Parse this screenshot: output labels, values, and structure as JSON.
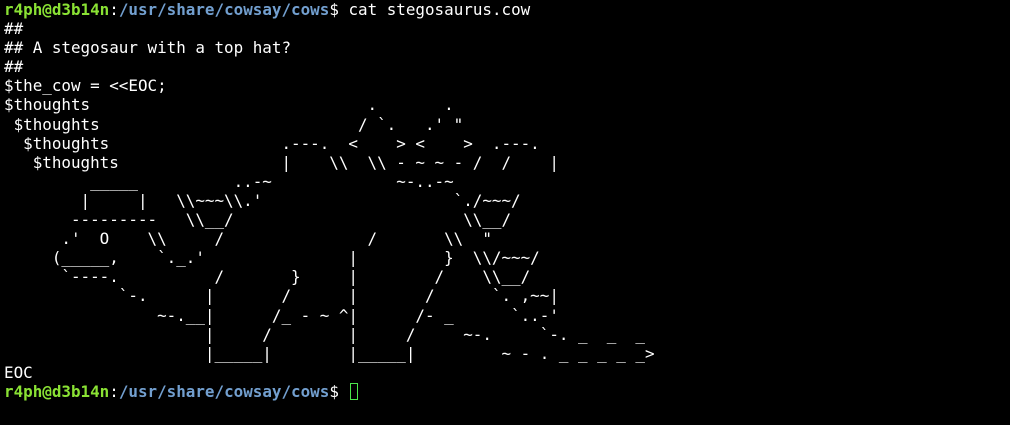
{
  "prompt1": {
    "user_host": "r4ph@d3b14n",
    "sep": ":",
    "path": "/usr/share/cowsay/cows",
    "symbol": "$",
    "command": " cat stegosaurus.cow"
  },
  "file_lines": [
    "##",
    "## A stegosaur with a top hat?",
    "##",
    "$the_cow = <<EOC;",
    "$thoughts                             .       .",
    " $thoughts                           / `.   .' \"",
    "  $thoughts                  .---.  <    > <    >  .---.",
    "   $thoughts                 |    \\\\  \\\\ - ~ ~ - /  /    |",
    "         _____          ..-~             ~-..-~",
    "        |     |   \\\\~~~\\\\.'                    `./~~~/",
    "       ---------   \\\\__/                        \\\\__/",
    "      .'  O    \\\\     /               /       \\\\  \"",
    "     (_____,    `._.'               |         }  \\\\/~~~/",
    "      `----.          /       }     |        /    \\\\__/",
    "            `-.      |       /      |       /      `. ,~~|",
    "                ~-.__|      /_ - ~ ^|      /- _      `..-'",
    "                     |     /        |     /     ~-.     `-. _  _  _",
    "                     |_____|        |_____|         ~ - . _ _ _ _ _>",
    "EOC"
  ],
  "prompt2": {
    "user_host": "r4ph@d3b14n",
    "sep": ":",
    "path": "/usr/share/cowsay/cows",
    "symbol": "$",
    "command": " "
  }
}
